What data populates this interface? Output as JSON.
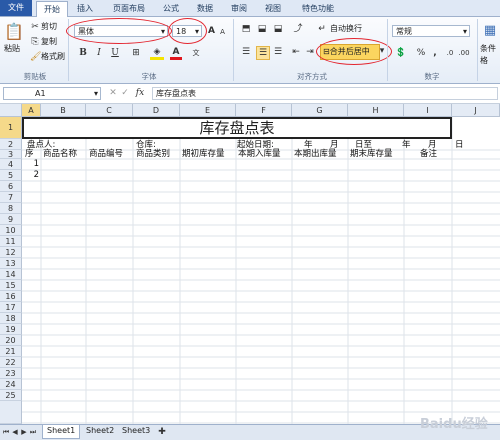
{
  "tabs": [
    "文件",
    "开始",
    "插入",
    "页面布局",
    "公式",
    "数据",
    "审阅",
    "视图",
    "特色功能"
  ],
  "clipboard": {
    "paste": "粘贴",
    "cut": "剪切",
    "copy": "复制",
    "format_painter": "格式刷",
    "group": "剪贴板"
  },
  "font": {
    "name": "黑体",
    "size": "18",
    "bold": "B",
    "italic": "I",
    "underline": "U",
    "grow": "A",
    "shrink": "A",
    "font_color": "A",
    "highlight": "A",
    "group": "字体"
  },
  "align": {
    "wrap": "自动换行",
    "merge": "合并后居中",
    "group": "对齐方式"
  },
  "number": {
    "format": "常规",
    "percent": "%",
    "comma": ",",
    "group": "数字"
  },
  "styles": {
    "label": "条件格"
  },
  "formula": {
    "cell_ref": "A1",
    "fx": "fx",
    "content": "库存盘点表"
  },
  "columns": [
    "A",
    "B",
    "C",
    "D",
    "E",
    "F",
    "G",
    "H",
    "I",
    "J"
  ],
  "rows": [
    "1",
    "2",
    "3",
    "4",
    "5",
    "6",
    "7",
    "8",
    "9",
    "10",
    "11",
    "12",
    "13",
    "14",
    "15",
    "16",
    "17",
    "18",
    "19",
    "20",
    "21",
    "22",
    "23",
    "24",
    "25"
  ],
  "sheet": {
    "title": "库存盘点表",
    "row2": [
      "盘点人:",
      "仓库:",
      "起始日期:",
      "年",
      "月",
      "日至",
      "年",
      "月",
      "日"
    ],
    "row3": [
      "序",
      "商品名称",
      "商品编号",
      "商品类别",
      "期初库存量",
      "本期入库量",
      "本期出库量",
      "期末库存量",
      "备注"
    ],
    "row4": "1",
    "row5": "2"
  },
  "sheets": [
    "Sheet1",
    "Sheet2",
    "Sheet3"
  ],
  "watermark": "Baidu经验"
}
